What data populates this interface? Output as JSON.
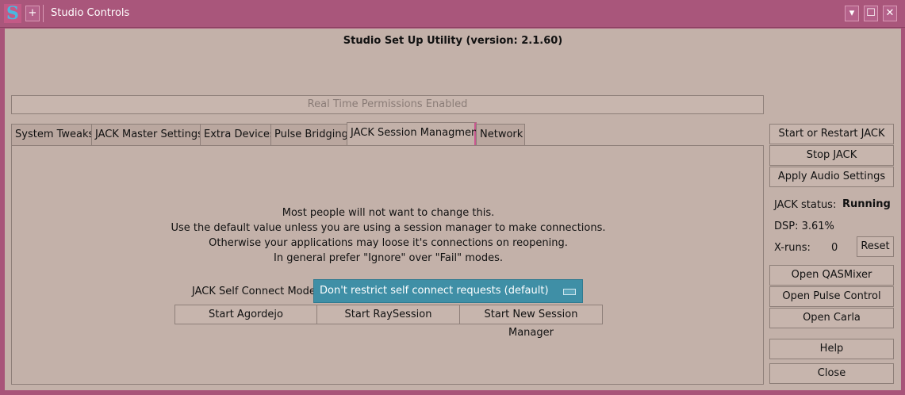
{
  "window": {
    "title": "Studio Controls",
    "logo_glyph": "S",
    "pin_glyph": "+",
    "min_glyph": "▾",
    "max_glyph": "☐",
    "close_glyph": "✕"
  },
  "app_title": "Studio Set Up Utility (version: 2.1.60)",
  "realtime_status": "Real Time Permissions Enabled",
  "tabs": [
    {
      "label": "System Tweaks"
    },
    {
      "label": "JACK Master Settings"
    },
    {
      "label": "Extra Devices"
    },
    {
      "label": "Pulse Bridging"
    },
    {
      "label": "JACK Session Managment"
    },
    {
      "label": "Network"
    }
  ],
  "session": {
    "info_lines": [
      "Most people will not want to change this.",
      "Use the default value unless you are using a session manager to make connections.",
      "Otherwise your applications may loose it's connections on reopening.",
      "In general prefer \"Ignore\" over \"Fail\" modes."
    ],
    "mode_label": "JACK Self Connect Mode:",
    "mode_value": "Don't restrict self connect requests (default)",
    "buttons": [
      "Start Agordejo",
      "Start RaySession",
      "Start New Session Manager"
    ]
  },
  "side": {
    "start_restart": "Start or Restart  JACK",
    "stop": "Stop JACK",
    "apply": "Apply Audio Settings",
    "status_label": "JACK status:",
    "status_value": "Running",
    "dsp": "DSP: 3.61%",
    "xruns_label": "X-runs:",
    "xruns_value": "0",
    "reset": "Reset",
    "open_qasmixer": "Open QASMixer",
    "open_pulse": "Open Pulse Control",
    "open_carla": "Open Carla",
    "help": "Help",
    "close": "Close"
  }
}
